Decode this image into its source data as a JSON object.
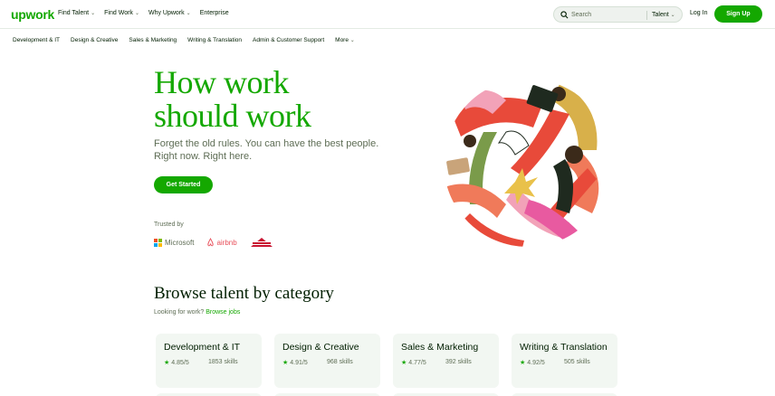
{
  "header": {
    "logo": "upwork",
    "nav": [
      {
        "label": "Find Talent",
        "has_dropdown": true
      },
      {
        "label": "Find Work",
        "has_dropdown": true
      },
      {
        "label": "Why Upwork",
        "has_dropdown": true
      },
      {
        "label": "Enterprise",
        "has_dropdown": false
      }
    ],
    "search": {
      "placeholder": "Search",
      "scope": "Talent"
    },
    "login": "Log In",
    "signup": "Sign Up"
  },
  "categories_nav": [
    "Development & IT",
    "Design & Creative",
    "Sales & Marketing",
    "Writing & Translation",
    "Admin & Customer Support",
    "More"
  ],
  "hero": {
    "title_line1": "How work",
    "title_line2": "should work",
    "subtitle_line1": "Forget the old rules. You can have the best people.",
    "subtitle_line2": "Right now. Right here.",
    "cta": "Get Started",
    "trusted_by": "Trusted by",
    "logos": [
      "Microsoft",
      "airbnb",
      "BISSELL"
    ]
  },
  "browse": {
    "title": "Browse talent by category",
    "sub_prefix": "Looking for work?",
    "sub_link": "Browse jobs",
    "cards": [
      {
        "title": "Development & IT",
        "rating": "4.85/5",
        "skills": "1853 skills"
      },
      {
        "title": "Design & Creative",
        "rating": "4.91/5",
        "skills": "968 skills"
      },
      {
        "title": "Sales & Marketing",
        "rating": "4.77/5",
        "skills": "392 skills"
      },
      {
        "title": "Writing & Translation",
        "rating": "4.92/5",
        "skills": "505 skills"
      }
    ]
  },
  "colors": {
    "brand": "#14a800",
    "text": "#001e00",
    "muted": "#5e6d55",
    "card_bg": "#f2f7f2"
  }
}
